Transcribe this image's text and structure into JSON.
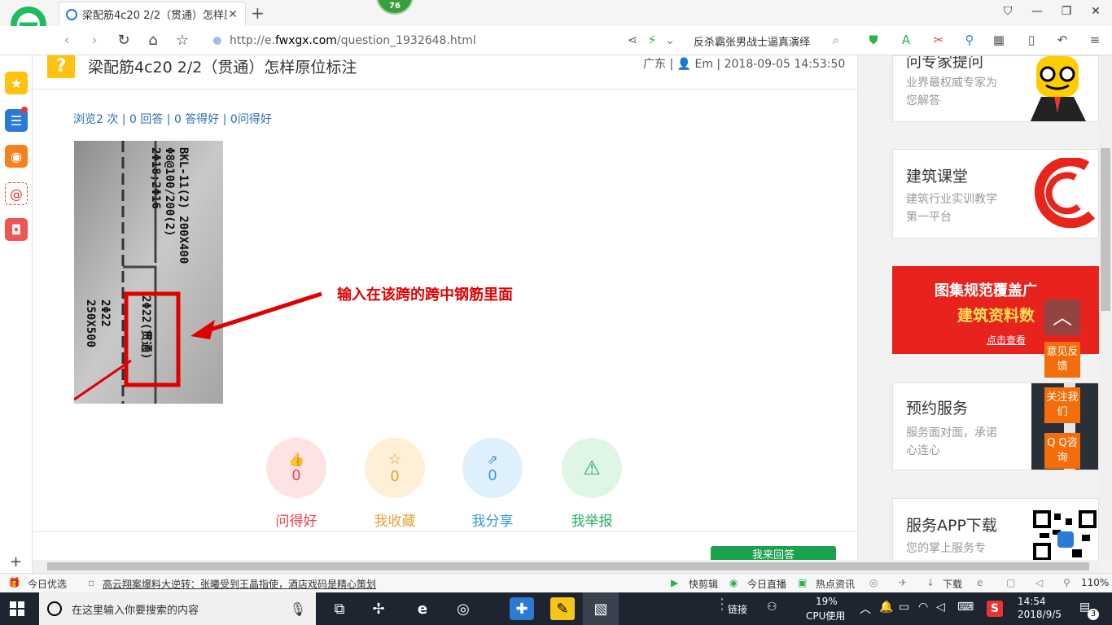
{
  "browser": {
    "tab_title": "梁配筋4c20 2/2（贯通）怎样原",
    "score_badge": "76",
    "url": {
      "prefix": "http://e.",
      "domain": "fwxgx.com",
      "path": "/question_1932648.html"
    },
    "search_hint": "反杀霸张男战士逼真演绎"
  },
  "page": {
    "title": "梁配筋4c20 2/2（贯通）怎样原位标注",
    "meta": "广东 | 👤 Em | 2018-09-05 14:53:50",
    "stats": "浏览2 次 | 0 回答 | 0 答得好 | 0问得好",
    "annotation": "输入在该跨的跨中钢筋里面",
    "photo_text": {
      "line1": "BKL-11(2) 200X400",
      "line2": "Φ8@100/200(2)",
      "line3": "2Φ18;2Φ16",
      "line4": "2Φ22(贯通)",
      "side1": "2Φ22",
      "side2": "250X500"
    },
    "actions": [
      {
        "icon": "thumb-up",
        "count": "0",
        "label": "问得好",
        "color": "#e8464b",
        "bg": "#fde3e4"
      },
      {
        "icon": "star",
        "count": "0",
        "label": "我收藏",
        "color": "#e6a23c",
        "bg": "#fdf0d7"
      },
      {
        "icon": "share",
        "count": "0",
        "label": "我分享",
        "color": "#3498db",
        "bg": "#dff0fd"
      },
      {
        "icon": "warning",
        "count": "",
        "label": "我举报",
        "color": "#27ae60",
        "bg": "#dff5e6"
      }
    ],
    "answer_button": "我来回答"
  },
  "rail": {
    "card1": {
      "title": "问专家提问",
      "sub": "业界最权威专家为您解答"
    },
    "card2": {
      "title": "建筑课堂",
      "sub": "建筑行业实训教学第一平台"
    },
    "banner": {
      "line1": "图集规范覆盖广",
      "line2": "建筑资料数",
      "cta": "点击查看"
    },
    "card3": {
      "title": "预约服务",
      "sub": "服务面对面，承诺心连心"
    },
    "card4": {
      "title": "服务APP下载",
      "sub": "您的掌上服务专"
    },
    "float": {
      "feedback": "意见反馈",
      "follow": "关注我们",
      "qq": "Q Q咨询"
    }
  },
  "statusbar": {
    "today_pick": "今日优选",
    "headline": "高云翔案爆料大逆转：张曦受到王晶指使，酒店戏码是精心策划",
    "quick_edit": "快剪辑",
    "live": "今日直播",
    "hot_news": "热点资讯",
    "download": "下载",
    "zoom": "110%"
  },
  "taskbar": {
    "search_placeholder": "在这里输入你要搜索的内容",
    "link": "链接",
    "cpu_pct": "19%",
    "cpu_label": "CPU使用",
    "time": "14:54",
    "date": "2018/9/5",
    "notif": "3",
    "ime": "S"
  }
}
